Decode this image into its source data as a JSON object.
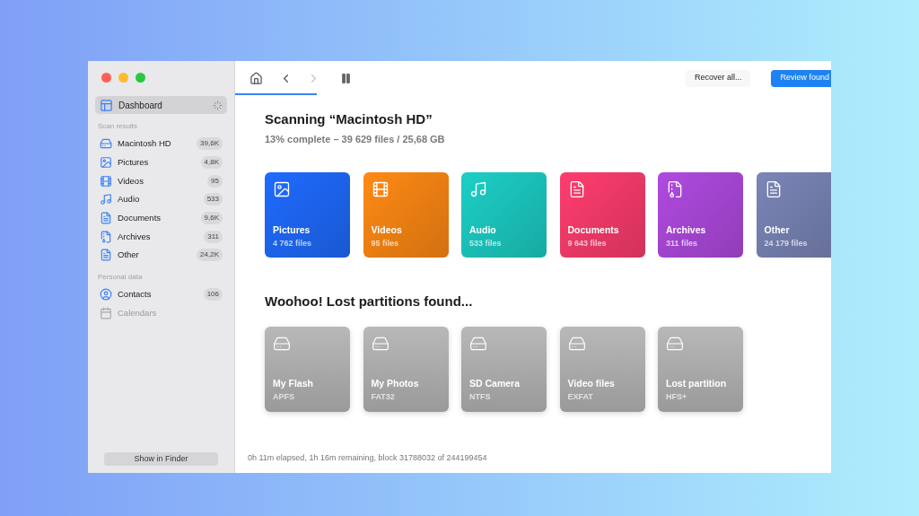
{
  "sidebar": {
    "items": [
      {
        "label": "Dashboard",
        "selected": true
      }
    ],
    "sections": [
      {
        "title": "Scan results",
        "items": [
          {
            "label": "Macintosh HD",
            "count": "39,6K",
            "selected": false,
            "disabled": false
          },
          {
            "label": "Pictures",
            "count": "4,8K",
            "selected": false,
            "disabled": false
          },
          {
            "label": "Videos",
            "count": "95",
            "selected": false,
            "disabled": false
          },
          {
            "label": "Audio",
            "count": "533",
            "selected": false,
            "disabled": false
          },
          {
            "label": "Documents",
            "count": "9,6K",
            "selected": false,
            "disabled": false
          },
          {
            "label": "Archives",
            "count": "311",
            "selected": false,
            "disabled": false
          },
          {
            "label": "Other",
            "count": "24,2K",
            "selected": false,
            "disabled": false
          }
        ]
      },
      {
        "title": "Personal data",
        "items": [
          {
            "label": "Contacts",
            "count": "106",
            "selected": false,
            "disabled": false
          },
          {
            "label": "Calendars",
            "selected": false,
            "disabled": true
          }
        ]
      }
    ],
    "footer_button": "Show in Finder"
  },
  "toolbar": {
    "forward_disabled": true,
    "buttons": [
      "Recover all...",
      "Review found"
    ]
  },
  "title": "Scanning “Macintosh HD”",
  "subtitle": "13% complete – 39 629 files / 25,68 GB",
  "categories": [
    {
      "name": "Pictures",
      "files": "4 762 files",
      "color": "#1f6bff"
    },
    {
      "name": "Videos",
      "files": "95 files",
      "color": "#ff8a14"
    },
    {
      "name": "Audio",
      "files": "533 files",
      "color": "#1ccfc6"
    },
    {
      "name": "Documents",
      "files": "9 643 files",
      "color": "#ff3d6e"
    },
    {
      "name": "Archives",
      "files": "311 files",
      "color": "#b04ae0"
    },
    {
      "name": "Other",
      "files": "24 179 files",
      "color": "#7b86b8"
    }
  ],
  "partitions_title": "Woohoo! Lost partitions found...",
  "partitions": [
    {
      "name": "My Flash",
      "format": "APFS"
    },
    {
      "name": "My Photos",
      "format": "FAT32"
    },
    {
      "name": "SD Camera",
      "format": "NTFS"
    },
    {
      "name": "Video files",
      "format": "EXFAT"
    },
    {
      "name": "Lost partition",
      "format": "HFS+"
    }
  ],
  "status": "0h 11m elapsed, 1h 16m remaining, block 31788032 of 244199454"
}
